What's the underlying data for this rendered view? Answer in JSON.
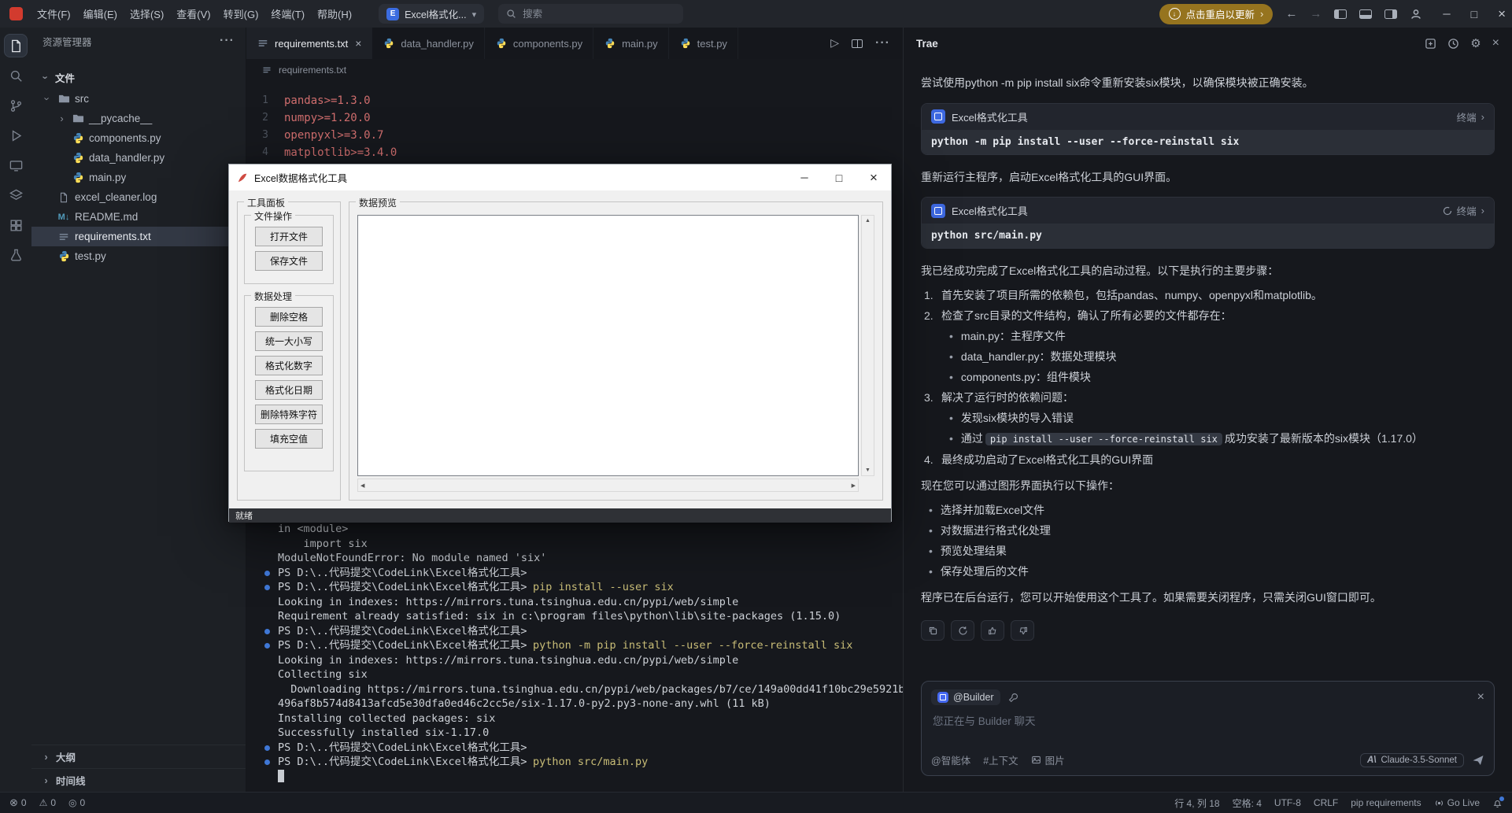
{
  "titlebar": {
    "menus": [
      "文件(F)",
      "编辑(E)",
      "选择(S)",
      "查看(V)",
      "转到(G)",
      "终端(T)",
      "帮助(H)"
    ],
    "project": {
      "icon_letter": "E",
      "label": "Excel格式化..."
    },
    "search_placeholder": "搜索",
    "update_label": "点击重启以更新"
  },
  "sidebar": {
    "title": "资源管理器",
    "files_section": "文件",
    "tree": [
      {
        "label": "src"
      },
      {
        "label": "__pycache__"
      },
      {
        "label": "components.py"
      },
      {
        "label": "data_handler.py"
      },
      {
        "label": "main.py"
      },
      {
        "label": "excel_cleaner.log"
      },
      {
        "label": "README.md"
      },
      {
        "label": "requirements.txt"
      },
      {
        "label": "test.py"
      }
    ],
    "outline_label": "大纲",
    "timeline_label": "时间线"
  },
  "editor": {
    "tabs": [
      {
        "label": "requirements.txt"
      },
      {
        "label": "data_handler.py"
      },
      {
        "label": "components.py"
      },
      {
        "label": "main.py"
      },
      {
        "label": "test.py"
      }
    ],
    "breadcrumb": "requirements.txt",
    "lines": [
      {
        "num": "1",
        "text": "pandas>=1.3.0"
      },
      {
        "num": "2",
        "text": "numpy>=1.20.0"
      },
      {
        "num": "3",
        "text": "openpyxl>=3.0.7"
      },
      {
        "num": "4",
        "text": "matplotlib>=3.4.0"
      }
    ]
  },
  "dialog": {
    "title": "Excel数据格式化工具",
    "tool_panel_title": "工具面板",
    "file_group": {
      "title": "文件操作",
      "buttons": [
        "打开文件",
        "保存文件"
      ]
    },
    "data_group": {
      "title": "数据处理",
      "buttons": [
        "删除空格",
        "统一大小写",
        "格式化数字",
        "格式化日期",
        "删除特殊字符",
        "填充空值"
      ]
    },
    "preview_title": "数据预览",
    "status": "就绪"
  },
  "terminal": {
    "lines": [
      {
        "text": "in <module>"
      },
      {
        "text": "    import six"
      },
      {
        "text": "ModuleNotFoundError: No module named 'six'"
      },
      {
        "prompt": "PS D:\\..代码提交\\CodeLink\\Excel格式化工具>",
        "cmd": ""
      },
      {
        "prompt": "PS D:\\..代码提交\\CodeLink\\Excel格式化工具>",
        "cmd": "pip install --user six"
      },
      {
        "text": "Looking in indexes: https://mirrors.tuna.tsinghua.edu.cn/pypi/web/simple"
      },
      {
        "text": "Requirement already satisfied: six in c:\\program files\\python\\lib\\site-packages (1.15.0)"
      },
      {
        "prompt": "PS D:\\..代码提交\\CodeLink\\Excel格式化工具>",
        "cmd": ""
      },
      {
        "prompt": "PS D:\\..代码提交\\CodeLink\\Excel格式化工具>",
        "cmd": "python -m pip install --user --force-reinstall six"
      },
      {
        "text": "Looking in indexes: https://mirrors.tuna.tsinghua.edu.cn/pypi/web/simple"
      },
      {
        "text": "Collecting six"
      },
      {
        "text": "  Downloading https://mirrors.tuna.tsinghua.edu.cn/pypi/web/packages/b7/ce/149a00dd41f10bc29e5921b"
      },
      {
        "text": "496af8b574d8413afcd5e30dfa0ed46c2cc5e/six-1.17.0-py2.py3-none-any.whl (11 kB)"
      },
      {
        "text": "Installing collected packages: six"
      },
      {
        "text": "Successfully installed six-1.17.0"
      },
      {
        "prompt": "PS D:\\..代码提交\\CodeLink\\Excel格式化工具>",
        "cmd": ""
      },
      {
        "prompt": "PS D:\\..代码提交\\CodeLink\\Excel格式化工具>",
        "cmd": "python src/main.py"
      }
    ]
  },
  "trae": {
    "title": "Trae",
    "messages": {
      "m1": "尝试使用python -m pip install six命令重新安装six模块，以确保模块被正确安装。",
      "m2": "重新运行主程序，启动Excel格式化工具的GUI界面。",
      "m3": "我已经成功完成了Excel格式化工具的启动过程。以下是执行的主要步骤：",
      "m4": "现在您可以通过图形界面执行以下操作：",
      "m5": "程序已在后台运行，您可以开始使用这个工具了。如果需要关闭程序，只需关闭GUI窗口即可。"
    },
    "cards": [
      {
        "app": "Excel格式化工具",
        "action": "终端",
        "command": "python -m pip install --user --force-reinstall six"
      },
      {
        "app": "Excel格式化工具",
        "action": "终端",
        "command": "python src/main.py"
      }
    ],
    "steps": [
      {
        "num": "1.",
        "text": "首先安装了项目所需的依赖包，包括pandas、numpy、openpyxl和matplotlib。"
      },
      {
        "num": "2.",
        "text": "检查了src目录的文件结构，确认了所有必要的文件都存在："
      },
      {
        "num": "3.",
        "text": "解决了运行时的依赖问题："
      },
      {
        "num": "4.",
        "text": "最终成功启动了Excel格式化工具的GUI界面"
      }
    ],
    "step2_items": [
      "main.py：主程序文件",
      "data_handler.py：数据处理模块",
      "components.py：组件模块"
    ],
    "step3_item1": "发现six模块的导入错误",
    "step3_pre": "通过",
    "step3_code": "pip install --user --force-reinstall six",
    "step3_post": "成功安装了最新版本的six模块（1.17.0）",
    "actions_list": [
      "选择并加载Excel文件",
      "对数据进行格式化处理",
      "预览处理结果",
      "保存处理后的文件"
    ],
    "input": {
      "agent": "@Builder",
      "placeholder": "您正在与 Builder 聊天",
      "tool_agent": "@智能体",
      "tool_context": "#上下文",
      "tool_image": "图片",
      "model_logo": "A\\",
      "model": "Claude-3.5-Sonnet"
    }
  },
  "statusbar": {
    "errors": "0",
    "warnings": "0",
    "extra": "0",
    "line_col": "行 4, 列 18",
    "spaces": "空格: 4",
    "encoding": "UTF-8",
    "eol": "CRLF",
    "language": "pip requirements",
    "golive": "Go Live"
  }
}
